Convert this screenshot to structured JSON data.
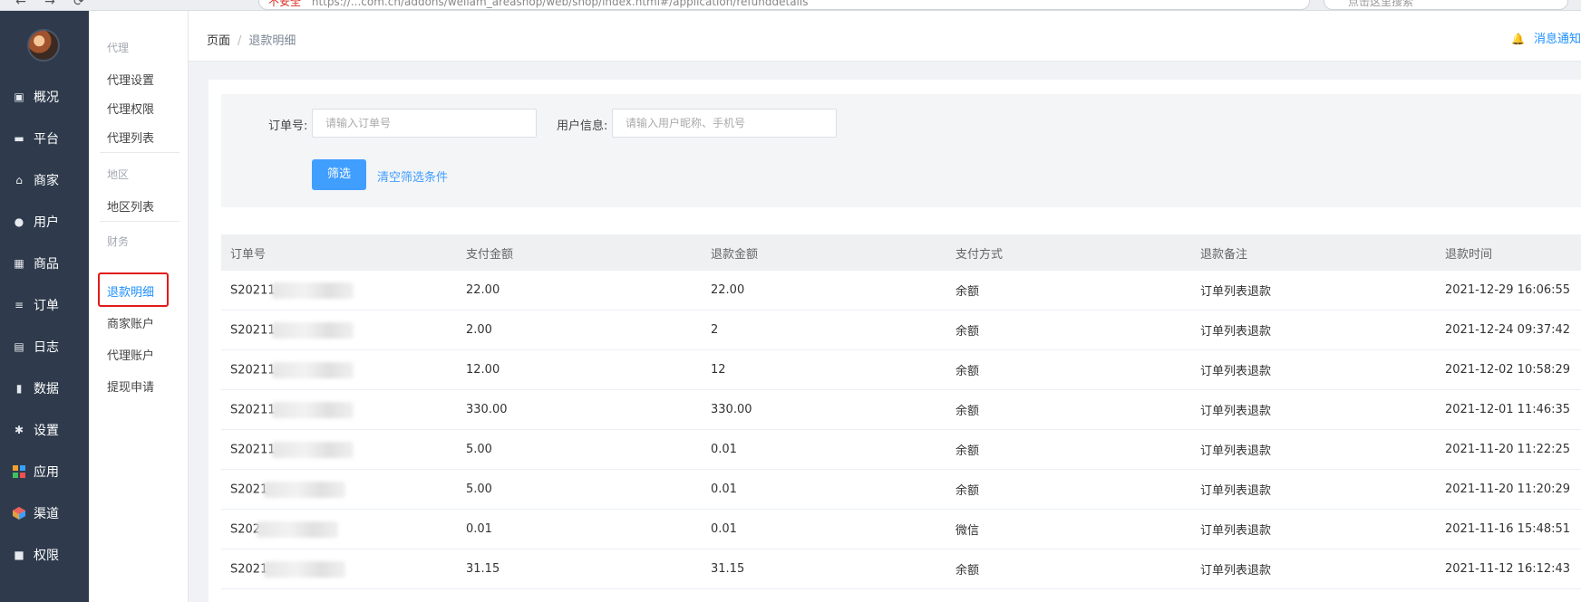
{
  "browser": {
    "nav_icons": [
      "←",
      "→",
      "⟳"
    ],
    "addr_warning": "不安全",
    "addr_text": "https://...com.cn/addons/weliam_areashop/web/shop/index.html#/application/refunddetails",
    "search_placeholder": "点击这里搜索"
  },
  "sidebar": {
    "items": [
      {
        "label": "概况",
        "icon": "overview-icon"
      },
      {
        "label": "平台",
        "icon": "platform-icon"
      },
      {
        "label": "商家",
        "icon": "store-icon"
      },
      {
        "label": "用户",
        "icon": "user-icon"
      },
      {
        "label": "商品",
        "icon": "goods-icon"
      },
      {
        "label": "订单",
        "icon": "order-icon"
      },
      {
        "label": "日志",
        "icon": "log-icon"
      },
      {
        "label": "数据",
        "icon": "chart-icon"
      },
      {
        "label": "设置",
        "icon": "gear-icon"
      },
      {
        "label": "应用",
        "icon": "apps-icon"
      },
      {
        "label": "渠道",
        "icon": "channel-icon"
      },
      {
        "label": "权限",
        "icon": "lock-icon"
      }
    ]
  },
  "subnav": {
    "group_agent": "代理",
    "agent_settings": "代理设置",
    "agent_permissions": "代理权限",
    "agent_list": "代理列表",
    "group_region": "地区",
    "region_list": "地区列表",
    "group_finance": "财务",
    "refund_details": "退款明细",
    "merchant_account": "商家账户",
    "agent_account": "代理账户",
    "withdraw_apply": "提现申请"
  },
  "header": {
    "crumb_home": "页面",
    "crumb_sep": "/",
    "crumb_current": "退款明细",
    "notice": "消息通知"
  },
  "filter": {
    "order_label": "订单号:",
    "order_placeholder": "请输入订单号",
    "user_label": "用户信息:",
    "user_placeholder": "请输入用户昵称、手机号",
    "filter_button": "筛选",
    "clear_link": "清空筛选条件"
  },
  "table": {
    "columns": [
      "订单号",
      "支付金额",
      "退款金额",
      "支付方式",
      "退款备注",
      "退款时间"
    ],
    "rows": [
      {
        "order": "S20211",
        "pay": "22.00",
        "refund": "22.00",
        "method": "余额",
        "remark": "订单列表退款",
        "time": "2021-12-29 16:06:55"
      },
      {
        "order": "S20211",
        "pay": "2.00",
        "refund": "2",
        "method": "余额",
        "remark": "订单列表退款",
        "time": "2021-12-24 09:37:42"
      },
      {
        "order": "S20211",
        "pay": "12.00",
        "refund": "12",
        "method": "余额",
        "remark": "订单列表退款",
        "time": "2021-12-02 10:58:29"
      },
      {
        "order": "S20211",
        "pay": "330.00",
        "refund": "330.00",
        "method": "余额",
        "remark": "订单列表退款",
        "time": "2021-12-01 11:46:35"
      },
      {
        "order": "S20211",
        "pay": "5.00",
        "refund": "0.01",
        "method": "余额",
        "remark": "订单列表退款",
        "time": "2021-11-20 11:22:25"
      },
      {
        "order": "S2021",
        "pay": "5.00",
        "refund": "0.01",
        "method": "余额",
        "remark": "订单列表退款",
        "time": "2021-11-20 11:20:29"
      },
      {
        "order": "S202",
        "pay": "0.01",
        "refund": "0.01",
        "method": "微信",
        "remark": "订单列表退款",
        "time": "2021-11-16 15:48:51"
      },
      {
        "order": "S2021",
        "pay": "31.15",
        "refund": "31.15",
        "method": "余额",
        "remark": "订单列表退款",
        "time": "2021-11-12 16:12:43"
      }
    ]
  },
  "colors": {
    "sidebar_bg": "#2f3b4c",
    "accent": "#409eff",
    "highlight_box": "#e21a1a"
  }
}
